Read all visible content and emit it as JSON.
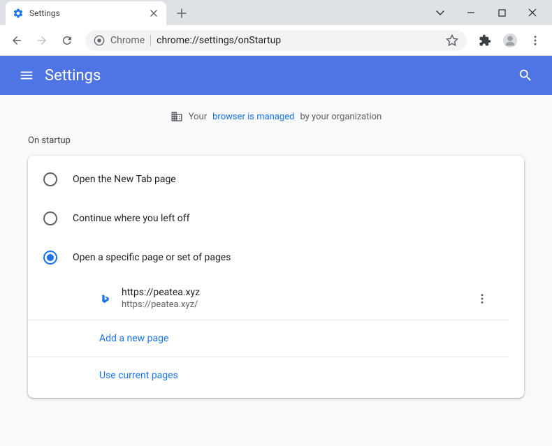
{
  "window": {
    "tab_title": "Settings"
  },
  "omnibox": {
    "chrome_label": "Chrome",
    "url": "chrome://settings/onStartup"
  },
  "header": {
    "title": "Settings"
  },
  "managed": {
    "prefix": "Your",
    "link": "browser is managed",
    "suffix": "by your organization"
  },
  "section": {
    "title": "On startup"
  },
  "options": [
    {
      "label": "Open the New Tab page",
      "selected": false
    },
    {
      "label": "Continue where you left off",
      "selected": false
    },
    {
      "label": "Open a specific page or set of pages",
      "selected": true
    }
  ],
  "pages": [
    {
      "title": "https://peatea.xyz",
      "url": "https://peatea.xyz/"
    }
  ],
  "actions": {
    "add": "Add a new page",
    "use_current": "Use current pages"
  }
}
